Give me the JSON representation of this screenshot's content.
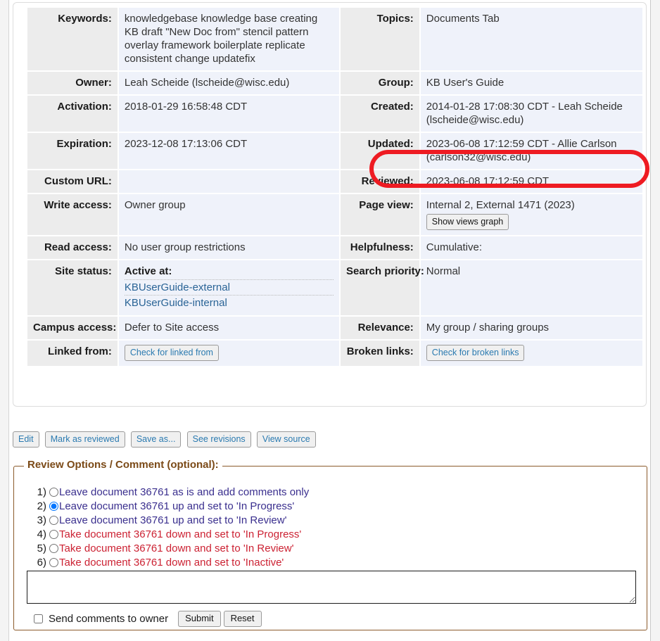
{
  "metadata": {
    "rows": [
      {
        "left_label": "Keywords:",
        "left_value": "knowledgebase knowledge base creating KB draft \"New Doc from\" stencil pattern overlay framework boilerplate replicate consistent change updatefix",
        "right_label": "Topics:",
        "right_value": "Documents Tab"
      },
      {
        "left_label": "Owner:",
        "left_value": "Leah Scheide (lscheide@wisc.edu)",
        "right_label": "Group:",
        "right_value": "KB User's Guide"
      },
      {
        "left_label": "Activation:",
        "left_value": "2018-01-29 16:58:48 CDT",
        "right_label": "Created:",
        "right_value": "2014-01-28 17:08:30 CDT - Leah Scheide (lscheide@wisc.edu)"
      },
      {
        "left_label": "Expiration:",
        "left_value": "2023-12-08 17:13:06 CDT",
        "right_label": "Updated:",
        "right_value": "2023-06-08 17:12:59 CDT - Allie Carlson (carlson32@wisc.edu)"
      },
      {
        "left_label": "Custom URL:",
        "left_value": "",
        "right_label": "Reviewed:",
        "right_value": "2023-06-08 17:12:59 CDT"
      },
      {
        "left_label": "Write access:",
        "left_value": "Owner group",
        "right_label": "Page view:",
        "right_value": "Internal 2, External 1471 (2023)"
      },
      {
        "left_label": "Read access:",
        "left_value": "No user group restrictions",
        "right_label": "Helpfulness:",
        "right_value": "Cumulative:"
      },
      {
        "left_label": "Site status:",
        "left_value": "Active at:",
        "right_label": "Search priority:",
        "right_value": "Normal"
      },
      {
        "left_label": "Campus access:",
        "left_value": "Defer to Site access",
        "right_label": "Relevance:",
        "right_value": "My group / sharing groups"
      },
      {
        "left_label": "Linked from:",
        "left_value": "",
        "right_label": "Broken links:",
        "right_value": ""
      }
    ],
    "site_status_links": [
      "KBUserGuide-external",
      "KBUserGuide-internal"
    ],
    "show_views_graph_label": "Show views graph",
    "check_linked_from_label": "Check for linked from",
    "check_broken_links_label": "Check for broken links"
  },
  "annotation": {
    "target_row": "Updated:",
    "color": "#ee1b22",
    "shape": "ellipse"
  },
  "action_bar": {
    "buttons": [
      "Edit",
      "Mark as reviewed",
      "Save as...",
      "See revisions",
      "View source"
    ]
  },
  "review": {
    "legend": "Review Options / Comment (optional):",
    "options": [
      {
        "num": "1)",
        "text": "Leave document 36761 as is and add comments only",
        "tone": "up",
        "selected": false
      },
      {
        "num": "2)",
        "text": "Leave document 36761 up and set to 'In Progress'",
        "tone": "up",
        "selected": true
      },
      {
        "num": "3)",
        "text": "Leave document 36761 up and set to 'In Review'",
        "tone": "up",
        "selected": false
      },
      {
        "num": "4)",
        "text": "Take document 36761 down and set to 'In Progress'",
        "tone": "down",
        "selected": false
      },
      {
        "num": "5)",
        "text": "Take document 36761 down and set to 'In Review'",
        "tone": "down",
        "selected": false
      },
      {
        "num": "6)",
        "text": "Take document 36761 down and set to 'Inactive'",
        "tone": "down",
        "selected": false
      }
    ],
    "comment_value": "",
    "comment_placeholder": "",
    "send_to_owner_label": "Send comments to owner",
    "send_to_owner_checked": false,
    "submit_label": "Submit",
    "reset_label": "Reset"
  }
}
